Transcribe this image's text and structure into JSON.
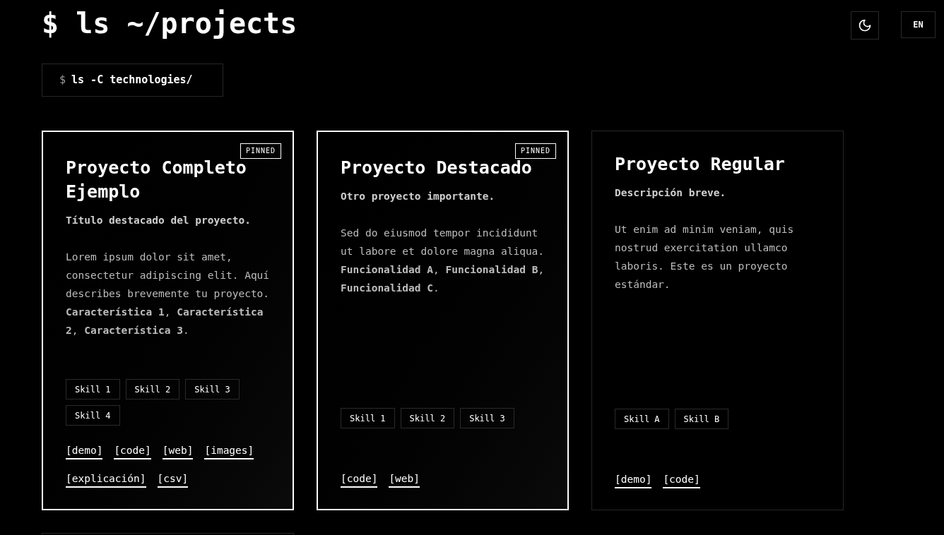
{
  "heading": "$ ls ~/projects",
  "theme_toggle": {
    "kind": "moon"
  },
  "language_button": "EN",
  "command": {
    "prompt": "$",
    "text": "ls -C technologies/"
  },
  "projects": [
    {
      "title": "Proyecto Completo Ejemplo",
      "pinned": true,
      "badge": "PINNED",
      "subtitle": "Título destacado del proyecto.",
      "description": "Lorem ipsum dolor sit amet, consectetur adipiscing elit. Aquí describes brevemente tu proyecto. **Característica 1**, **Característica 2**, **Característica 3**.",
      "skills": [
        "Skill 1",
        "Skill 2",
        "Skill 3",
        "Skill 4"
      ],
      "links": [
        "[demo]",
        "[code]",
        "[web]",
        "[images]",
        "[explicación]",
        "[csv]"
      ]
    },
    {
      "title": "Proyecto Destacado",
      "pinned": true,
      "badge": "PINNED",
      "subtitle": "Otro proyecto importante.",
      "description": "Sed do eiusmod tempor incididunt ut labore et dolore magna aliqua. **Funcionalidad A**, **Funcionalidad B**, **Funcionalidad C**.",
      "skills": [
        "Skill 1",
        "Skill 2",
        "Skill 3"
      ],
      "links": [
        "[code]",
        "[web]"
      ]
    },
    {
      "title": "Proyecto Regular",
      "pinned": false,
      "subtitle": "Descripción breve.",
      "description": "Ut enim ad minim veniam, quis nostrud exercitation ullamco laboris. Este es un proyecto estándar.",
      "skills": [
        "Skill A",
        "Skill B"
      ],
      "links": [
        "[demo]",
        "[code]"
      ]
    }
  ]
}
